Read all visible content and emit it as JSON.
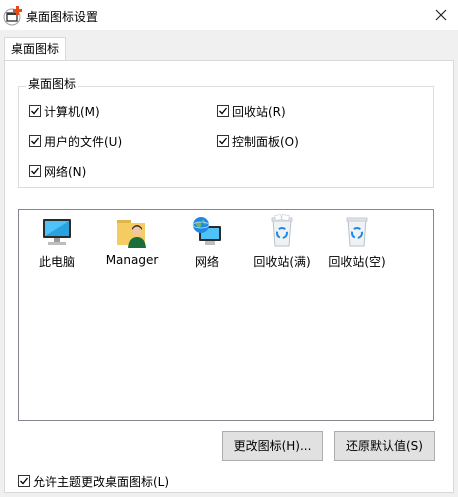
{
  "window": {
    "title": "桌面图标设置"
  },
  "tabs": [
    {
      "label": "桌面图标"
    }
  ],
  "group": {
    "label": "桌面图标",
    "checkboxes": [
      {
        "label": "计算机(M)",
        "checked": true
      },
      {
        "label": "回收站(R)",
        "checked": true
      },
      {
        "label": "用户的文件(U)",
        "checked": true
      },
      {
        "label": "控制面板(O)",
        "checked": true
      },
      {
        "label": "网络(N)",
        "checked": true
      }
    ]
  },
  "icons": [
    {
      "label": "此电脑",
      "icon": "computer-icon"
    },
    {
      "label": "Manager",
      "icon": "user-folder-icon"
    },
    {
      "label": "网络",
      "icon": "network-icon"
    },
    {
      "label": "回收站(满)",
      "icon": "recycle-bin-full-icon"
    },
    {
      "label": "回收站(空)",
      "icon": "recycle-bin-empty-icon"
    }
  ],
  "buttons": {
    "change_icon": "更改图标(H)...",
    "restore_default": "还原默认值(S)"
  },
  "theme_option": {
    "label": "允许主题更改桌面图标(L)",
    "checked": true
  },
  "colors": {
    "accent": "#1e88e5",
    "titlebar": "#ffffff",
    "panel": "#ffffff",
    "window_bg": "#f0f0f0"
  }
}
